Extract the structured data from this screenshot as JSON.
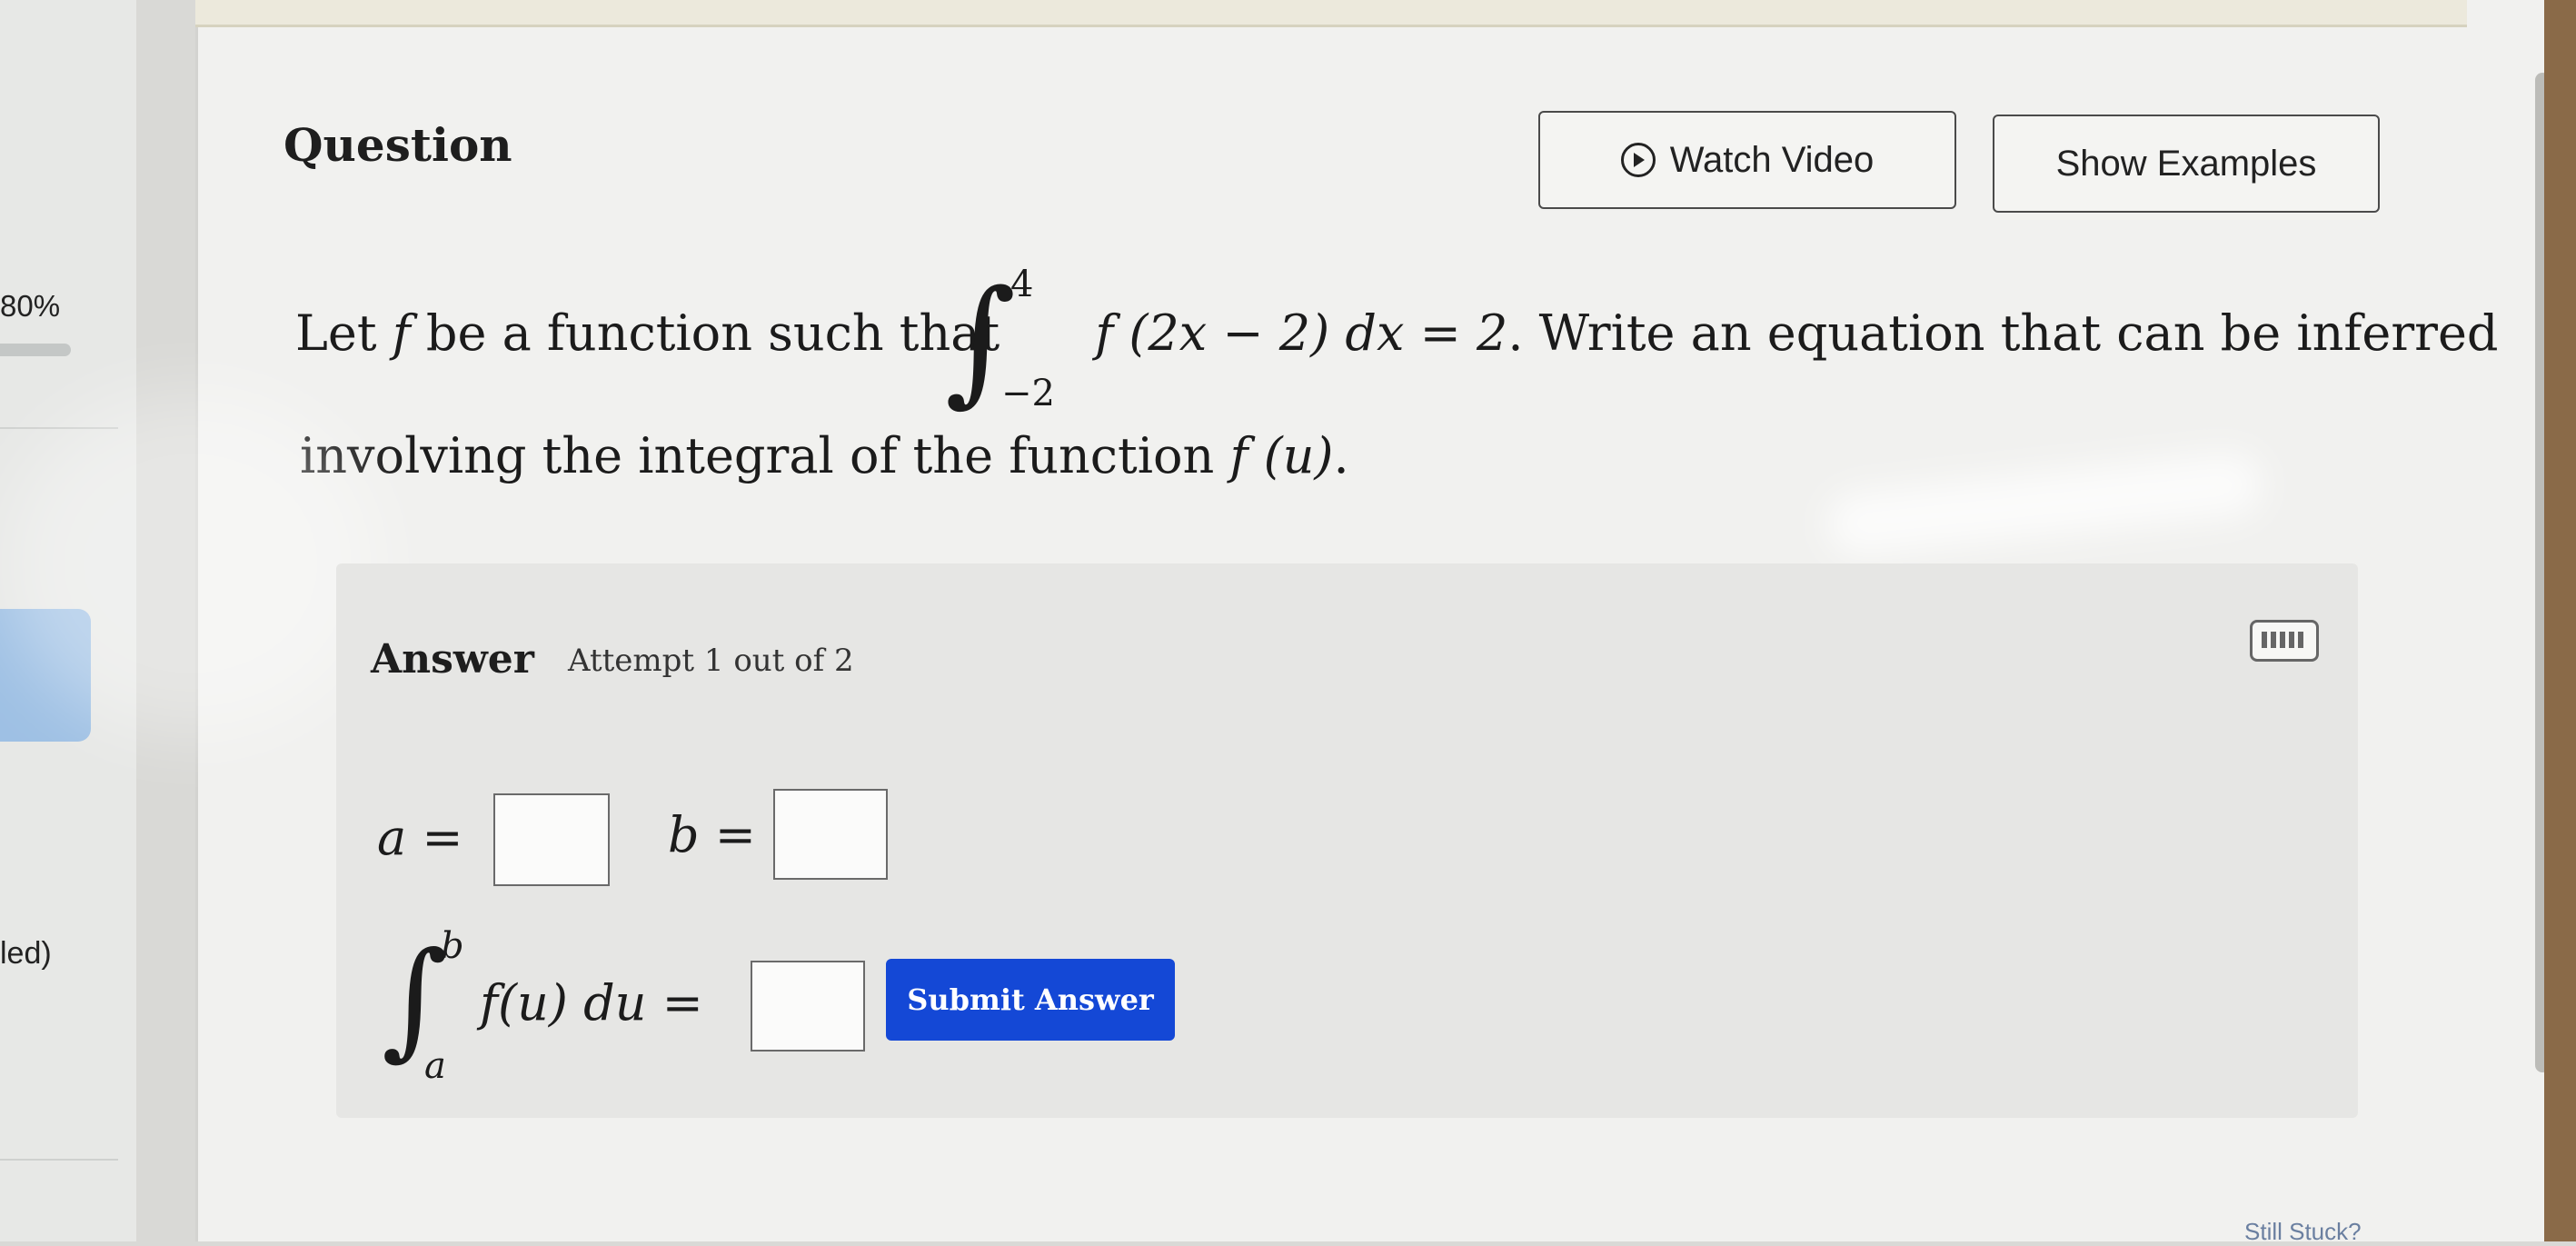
{
  "sidebar": {
    "progress_label": "80%",
    "status_fragment": "led)"
  },
  "header": {
    "title": "Question",
    "watch_video_label": "Watch Video",
    "show_examples_label": "Show Examples"
  },
  "question": {
    "line1_prefix": "Let",
    "line1_f": "f",
    "line1_mid": "be a function such that",
    "integral_upper": "4",
    "integral_lower": "−2",
    "integrand": "f (2x − 2) dx = 2",
    "line1_suffix": ". Write an equation that can be inferred",
    "line2_prefix": "involving the integral of the function",
    "line2_math": "f (u)",
    "line2_suffix": "."
  },
  "answer": {
    "label": "Answer",
    "attempt": "Attempt 1 out of 2",
    "a_label": "a =",
    "b_label": "b =",
    "integral_upper": "b",
    "integral_lower": "a",
    "integral_expr": "f(u) du =",
    "submit_label": "Submit Answer"
  },
  "footer": {
    "peek_text": "Still Stuck?"
  },
  "colors": {
    "submit_bg": "#1448d6",
    "card_bg": "#f1f1ef",
    "panel_bg": "#e6e6e4"
  },
  "icons": [
    "play-circle-icon",
    "keyboard-icon"
  ]
}
